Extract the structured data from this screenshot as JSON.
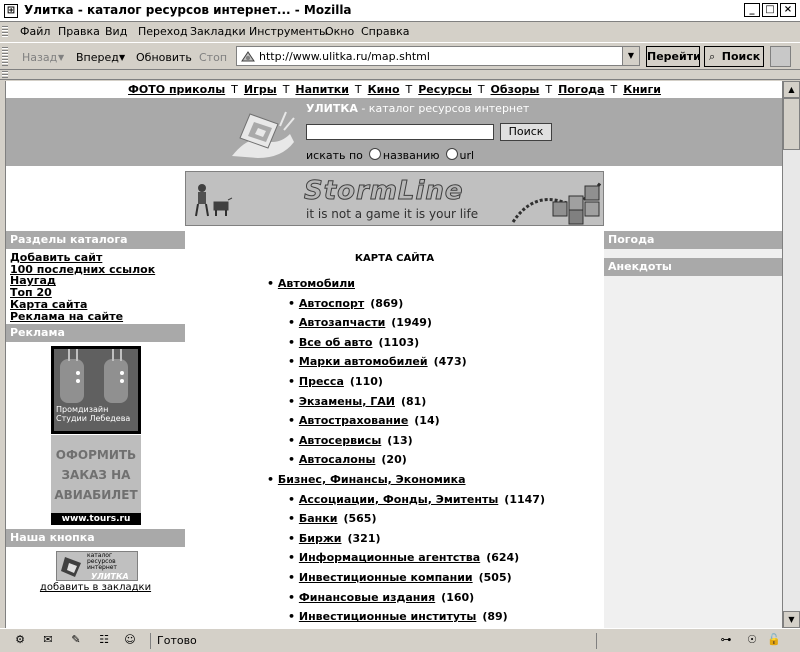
{
  "window": {
    "title": "Улитка - каталог ресурсов интернет... - Mozilla"
  },
  "menu": [
    "Файл",
    "Правка",
    "Вид",
    "Переход",
    "Закладки",
    "Инструменты",
    "Окно",
    "Справка"
  ],
  "nav": {
    "back": "Назад",
    "forward": "Вперед",
    "reload": "Обновить",
    "stop": "Стоп",
    "url": "http://www.ulitka.ru/map.shtml",
    "go": "Перейти",
    "search": "Поиск"
  },
  "page": {
    "topnav": [
      "ФОТО приколы",
      "Игры",
      "Напитки",
      "Кино",
      "Ресурсы",
      "Обзоры",
      "Погода",
      "Книги"
    ],
    "topnav_sep": "Т",
    "brand_name": "УЛИТКА",
    "brand_tagline": " - каталог ресурсов интернет",
    "search_button": "Поиск",
    "search_by": "искать по",
    "radio_name": "названию",
    "radio_url": "url",
    "banner_logo": "StormLine",
    "banner_slogan": "it is not a game it is your life",
    "left": {
      "sections_title": "Разделы каталога",
      "links": [
        "Добавить сайт",
        "100 последних ссылок",
        "Наугад",
        "Топ 20",
        "Карта сайта",
        "Реклама на сайте"
      ],
      "ads_title": "Реклама",
      "ad1_caption_1": "Промдизайн",
      "ad1_caption_2": "Студии Лебедева",
      "ad2_text_1": "ОФОРМИТЬ",
      "ad2_text_2": "ЗАКАЗ НА",
      "ad2_text_3": "АВИАБИЛЕТ",
      "ad2_site": "www.tours.ru",
      "button_title": "Наша кнопка",
      "button_logo_top_1": "каталог",
      "button_logo_top_2": "ресурсов",
      "button_logo_top_3": "интернет",
      "button_logo_name": "УЛИТКА",
      "add_bookmark": "добавить в закладки"
    },
    "sitemap": {
      "title": "КАРТА САЙТА",
      "categories": [
        {
          "name": "Автомобили",
          "subs": [
            {
              "name": "Автоспорт",
              "count": "(869)"
            },
            {
              "name": "Автозапчасти",
              "count": "(1949)"
            },
            {
              "name": "Все об авто",
              "count": "(1103)"
            },
            {
              "name": "Марки автомобилей",
              "count": "(473)"
            },
            {
              "name": "Пресса",
              "count": "(110)"
            },
            {
              "name": "Экзамены, ГАИ",
              "count": "(81)"
            },
            {
              "name": "Автострахование",
              "count": "(14)"
            },
            {
              "name": "Автосервисы",
              "count": "(13)"
            },
            {
              "name": "Автосалоны",
              "count": "(20)"
            }
          ]
        },
        {
          "name": "Бизнес, Финансы, Экономика",
          "subs": [
            {
              "name": "Ассоциации, Фонды, Эмитенты",
              "count": "(1147)"
            },
            {
              "name": "Банки",
              "count": "(565)"
            },
            {
              "name": "Биржи",
              "count": "(321)"
            },
            {
              "name": "Информационные агентства",
              "count": "(624)"
            },
            {
              "name": "Инвестиционные компании",
              "count": "(505)"
            },
            {
              "name": "Финансовые издания",
              "count": "(160)"
            },
            {
              "name": "Инвестиционные институты",
              "count": "(89)"
            }
          ]
        }
      ]
    },
    "right": {
      "weather": "Погода",
      "jokes": "Анекдоты"
    }
  },
  "status": {
    "text": "Готово"
  }
}
